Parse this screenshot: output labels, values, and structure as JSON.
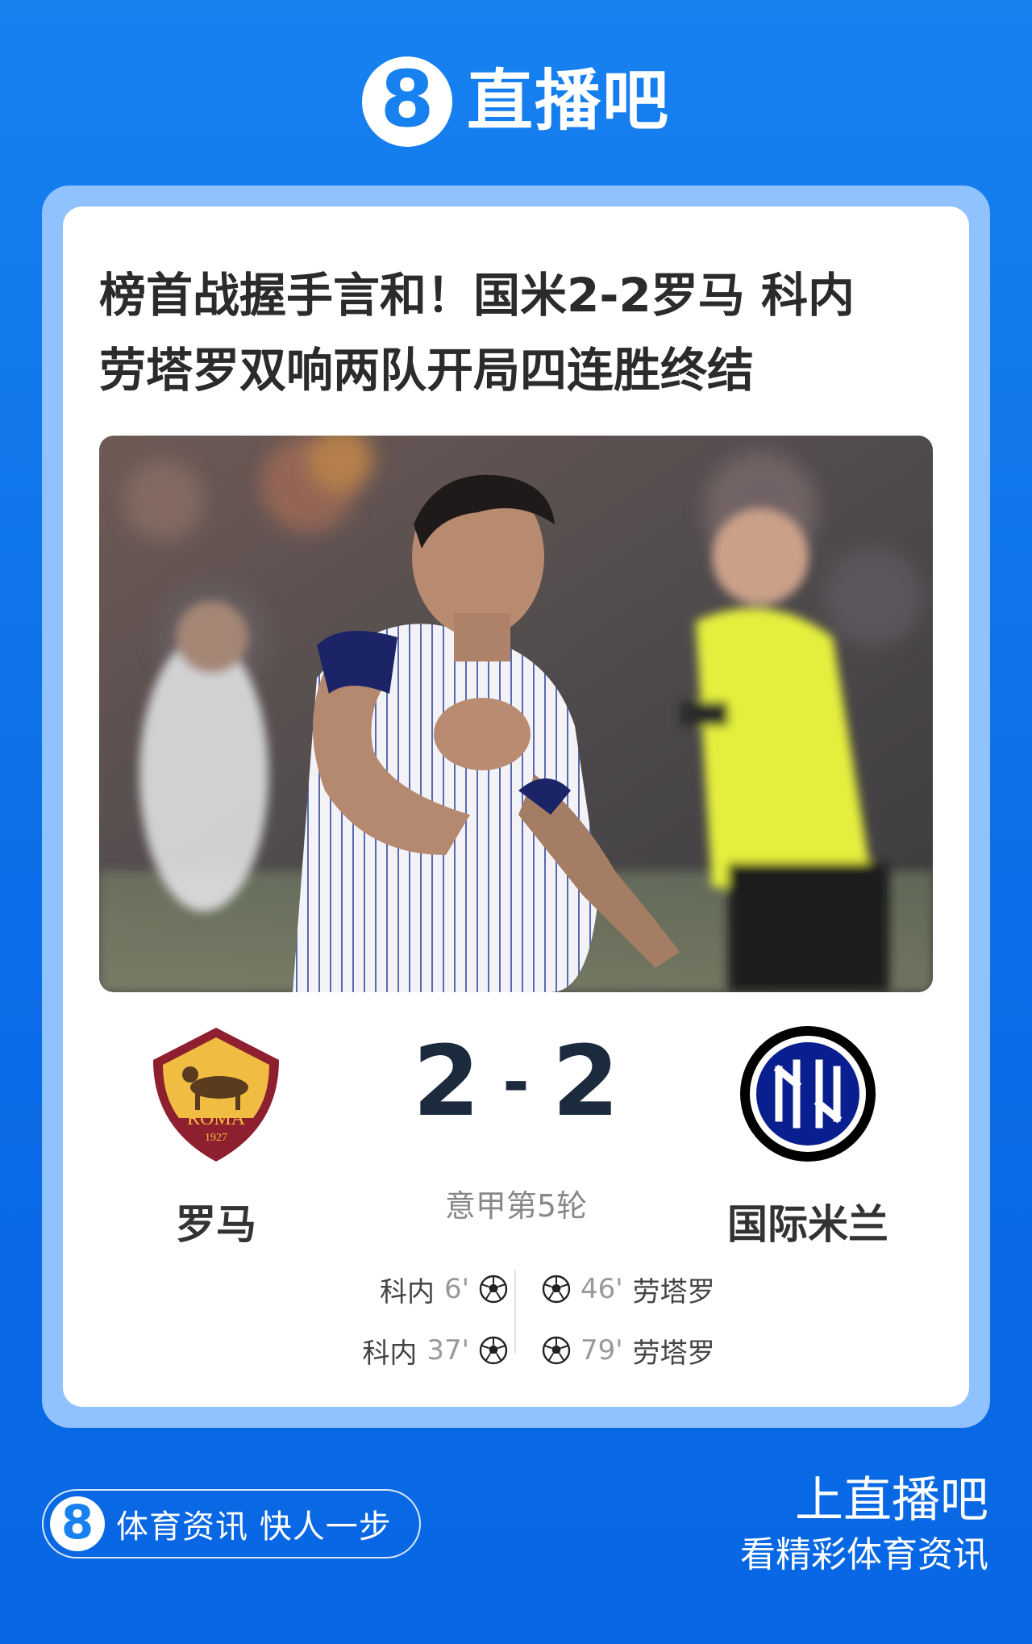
{
  "brand": {
    "badge_glyph": "8",
    "name": "直播吧"
  },
  "article": {
    "headline_line1": "榜首战握手言和！国米2-2罗马 科内",
    "headline_line2": "劳塔罗双响两队开局四连胜终结"
  },
  "match": {
    "home_team": "罗马",
    "home_logo_text": "ROMA",
    "home_logo_year": "1927",
    "away_team": "国际米兰",
    "home_score": "2",
    "separator": "-",
    "away_score": "2",
    "round": "意甲第5轮"
  },
  "goals": {
    "home": [
      {
        "player": "科内",
        "minute": "6'"
      },
      {
        "player": "科内",
        "minute": "37'"
      }
    ],
    "away": [
      {
        "player": "劳塔罗",
        "minute": "46'"
      },
      {
        "player": "劳塔罗",
        "minute": "79'"
      }
    ]
  },
  "footer": {
    "slogan_glyph": "8",
    "slogan": "体育资讯 快人一步",
    "cta_title": "上直播吧",
    "cta_subtitle": "看精彩体育资讯"
  },
  "colors": {
    "background": "#1781f0",
    "card_border": "#8fc2ff",
    "score": "#1c2a3d",
    "roma_red": "#8e1f2f",
    "roma_gold": "#f0bc42",
    "inter_blue": "#0a1f8f"
  }
}
